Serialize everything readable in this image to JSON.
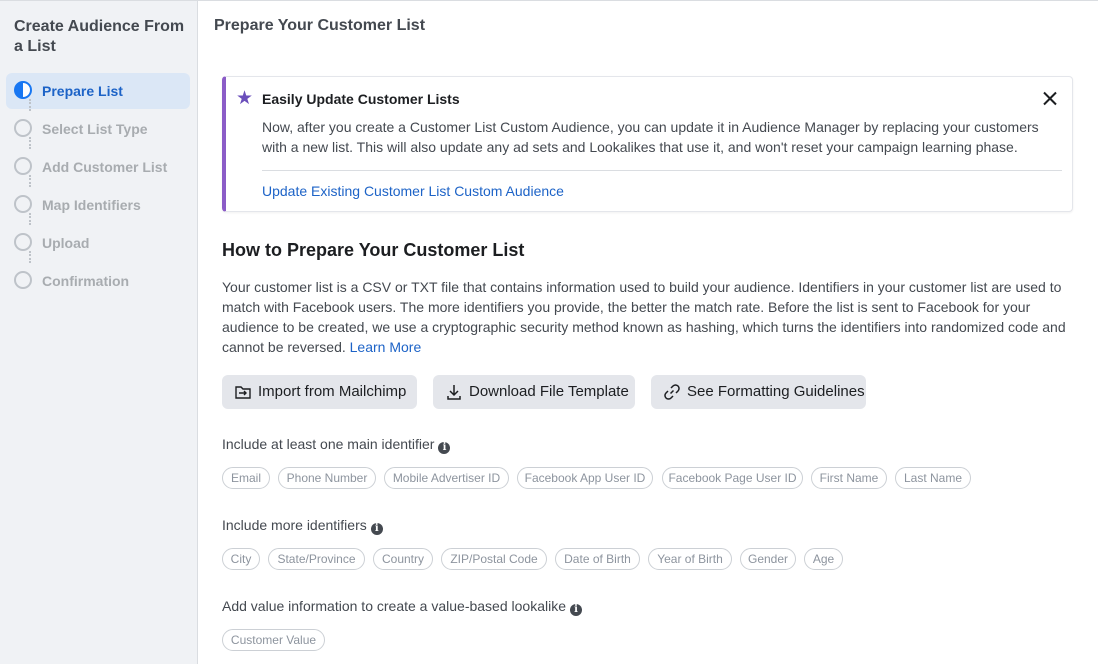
{
  "sidebar": {
    "title": "Create Audience From a List",
    "steps": [
      {
        "label": "Prepare List",
        "active": true
      },
      {
        "label": "Select List Type",
        "active": false
      },
      {
        "label": "Add Customer List",
        "active": false
      },
      {
        "label": "Map Identifiers",
        "active": false
      },
      {
        "label": "Upload",
        "active": false
      },
      {
        "label": "Confirmation",
        "active": false
      }
    ]
  },
  "main": {
    "title": "Prepare Your Customer List",
    "notice": {
      "icon": "star-icon",
      "title": "Easily Update Customer Lists",
      "body": "Now, after you create a Customer List Custom Audience, you can update it in Audience Manager by replacing your customers with a new list. This will also update any ad sets and Lookalikes that use it, and won't reset your campaign learning phase.",
      "link": "Update Existing Customer List Custom Audience"
    },
    "howto": {
      "heading": "How to Prepare Your Customer List",
      "body": "Your customer list is a CSV or TXT file that contains information used to build your audience. Identifiers in your customer list are used to match with Facebook users. The more identifiers you provide, the better the match rate. Before the list is sent to Facebook for your audience to be created, we use a cryptographic security method known as hashing, which turns the identifiers into randomized code and cannot be reversed.",
      "learn_more": "Learn More"
    },
    "buttons": {
      "mailchimp": "Import from Mailchimp",
      "template": "Download File Template",
      "guidelines": "See Formatting Guidelines"
    },
    "main_identifiers": {
      "label": "Include at least one main identifier",
      "chips": [
        "Email",
        "Phone Number",
        "Mobile Advertiser ID",
        "Facebook App User ID",
        "Facebook Page User ID",
        "First Name",
        "Last Name"
      ]
    },
    "more_identifiers": {
      "label": "Include more identifiers",
      "chips": [
        "City",
        "State/Province",
        "Country",
        "ZIP/Postal Code",
        "Date of Birth",
        "Year of Birth",
        "Gender",
        "Age"
      ]
    },
    "value_info": {
      "label": "Add value information to create a value-based lookalike",
      "chips": [
        "Customer Value"
      ]
    }
  },
  "colors": {
    "accent": "#1877f2",
    "link": "#1d63c7",
    "notice_border": "#8b5cc7",
    "sidebar_bg": "#f0f2f5"
  }
}
